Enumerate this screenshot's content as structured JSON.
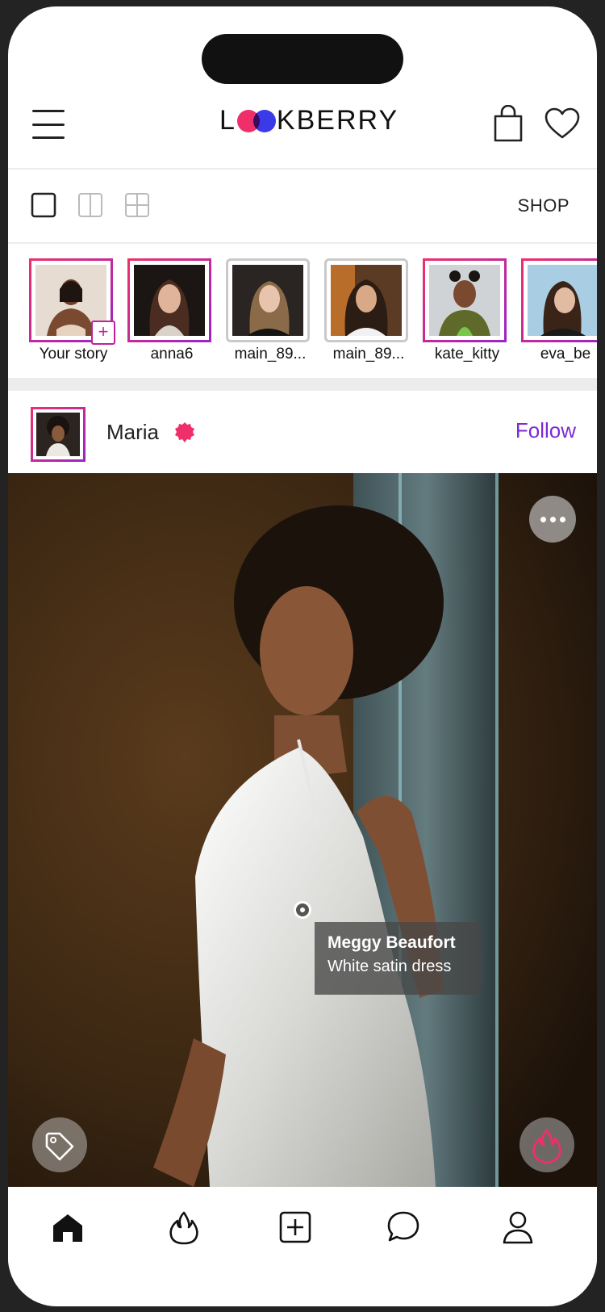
{
  "app": {
    "brand_left": "L",
    "brand_right": "KBERRY"
  },
  "viewbar": {
    "shop_label": "SHOP"
  },
  "stories": [
    {
      "name": "Your story",
      "seen": false,
      "own": true
    },
    {
      "name": "anna6",
      "seen": false
    },
    {
      "name": "main_89...",
      "seen": true
    },
    {
      "name": "main_89...",
      "seen": true
    },
    {
      "name": "kate_kitty",
      "seen": false
    },
    {
      "name": "eva_be",
      "seen": false
    }
  ],
  "post": {
    "username": "Maria",
    "follow_label": "Follow",
    "product_tag": {
      "brand": "Meggy Beaufort",
      "item": "White satin dress"
    }
  },
  "colors": {
    "accent_pink": "#ef2f6a",
    "accent_purple": "#7b2bd4",
    "brand_blue": "#3a3ae8"
  }
}
